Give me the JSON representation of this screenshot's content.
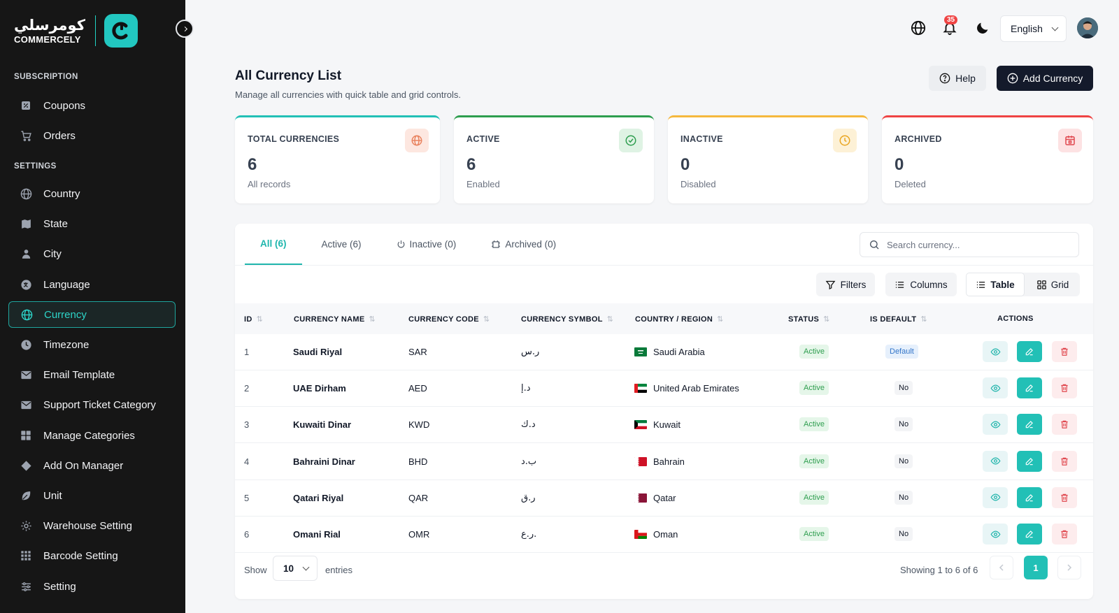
{
  "brand": {
    "name_ar": "كومرسلي",
    "name_en": "COMMERCELY"
  },
  "sidebar": {
    "sections": [
      {
        "label": "SUBSCRIPTION",
        "items": [
          {
            "label": "Coupons",
            "icon": "percent-icon"
          },
          {
            "label": "Orders",
            "icon": "cart-icon"
          }
        ]
      },
      {
        "label": "SETTINGS",
        "items": [
          {
            "label": "Country",
            "icon": "globe-icon"
          },
          {
            "label": "State",
            "icon": "map-icon"
          },
          {
            "label": "City",
            "icon": "building-icon"
          },
          {
            "label": "Language",
            "icon": "language-icon"
          },
          {
            "label": "Currency",
            "icon": "globe-icon",
            "active": true
          },
          {
            "label": "Timezone",
            "icon": "clock-icon"
          },
          {
            "label": "Email Template",
            "icon": "mail-icon"
          },
          {
            "label": "Support Ticket Category",
            "icon": "mail-icon"
          },
          {
            "label": "Manage Categories",
            "icon": "grid-icon"
          },
          {
            "label": "Add On Manager",
            "icon": "diamond-icon"
          },
          {
            "label": "Unit",
            "icon": "leaf-icon"
          },
          {
            "label": "Warehouse Setting",
            "icon": "gear-icon"
          },
          {
            "label": "Barcode Setting",
            "icon": "dots-grid-icon"
          },
          {
            "label": "Setting",
            "icon": "sliders-icon"
          }
        ]
      }
    ]
  },
  "topbar": {
    "notification_count": "35",
    "language": "English"
  },
  "header": {
    "title": "All Currency List",
    "subtitle": "Manage all currencies with quick table and grid controls.",
    "help_label": "Help",
    "add_label": "Add Currency"
  },
  "stats": [
    {
      "label": "TOTAL CURRENCIES",
      "value": "6",
      "sub": "All records",
      "color": "#22c0b6",
      "icon_bg": "#fde7e0",
      "icon_color": "#e9835f"
    },
    {
      "label": "ACTIVE",
      "value": "6",
      "sub": "Enabled",
      "color": "#2e9e4f",
      "icon_bg": "#dff3e4",
      "icon_color": "#2e9e4f"
    },
    {
      "label": "INACTIVE",
      "value": "0",
      "sub": "Disabled",
      "color": "#f5b83d",
      "icon_bg": "#fdf1d6",
      "icon_color": "#e9a520"
    },
    {
      "label": "ARCHIVED",
      "value": "0",
      "sub": "Deleted",
      "color": "#ef4444",
      "icon_bg": "#fde2e3",
      "icon_color": "#e0484f"
    }
  ],
  "tabs": [
    {
      "label": "All (6)",
      "active": true
    },
    {
      "label": "Active (6)"
    },
    {
      "label": "Inactive (0)"
    },
    {
      "label": "Archived (0)"
    }
  ],
  "search": {
    "placeholder": "Search currency..."
  },
  "toolbar": {
    "filters": "Filters",
    "columns": "Columns",
    "table": "Table",
    "grid": "Grid"
  },
  "table": {
    "columns": [
      "ID",
      "CURRENCY NAME",
      "CURRENCY CODE",
      "CURRENCY SYMBOL",
      "COUNTRY / REGION",
      "STATUS",
      "IS DEFAULT",
      "ACTIONS"
    ],
    "rows": [
      {
        "id": "1",
        "name": "Saudi Riyal",
        "code": "SAR",
        "symbol": "ر.س",
        "country": "Saudi Arabia",
        "flag": "sa",
        "status": "Active",
        "default": "Default"
      },
      {
        "id": "2",
        "name": "UAE Dirham",
        "code": "AED",
        "symbol": "د.إ",
        "country": "United Arab Emirates",
        "flag": "ae",
        "status": "Active",
        "default": "No"
      },
      {
        "id": "3",
        "name": "Kuwaiti Dinar",
        "code": "KWD",
        "symbol": "د.ك",
        "country": "Kuwait",
        "flag": "kw",
        "status": "Active",
        "default": "No"
      },
      {
        "id": "4",
        "name": "Bahraini Dinar",
        "code": "BHD",
        "symbol": "ب.د",
        "country": "Bahrain",
        "flag": "bh",
        "status": "Active",
        "default": "No"
      },
      {
        "id": "5",
        "name": "Qatari Riyal",
        "code": "QAR",
        "symbol": "ر.ق",
        "country": "Qatar",
        "flag": "qa",
        "status": "Active",
        "default": "No"
      },
      {
        "id": "6",
        "name": "Omani Rial",
        "code": "OMR",
        "symbol": "ر.ع.",
        "country": "Oman",
        "flag": "om",
        "status": "Active",
        "default": "No"
      }
    ]
  },
  "footer": {
    "show": "Show",
    "entries_value": "10",
    "entries": "entries",
    "showing": "Showing 1 to 6 of 6",
    "current_page": "1"
  }
}
